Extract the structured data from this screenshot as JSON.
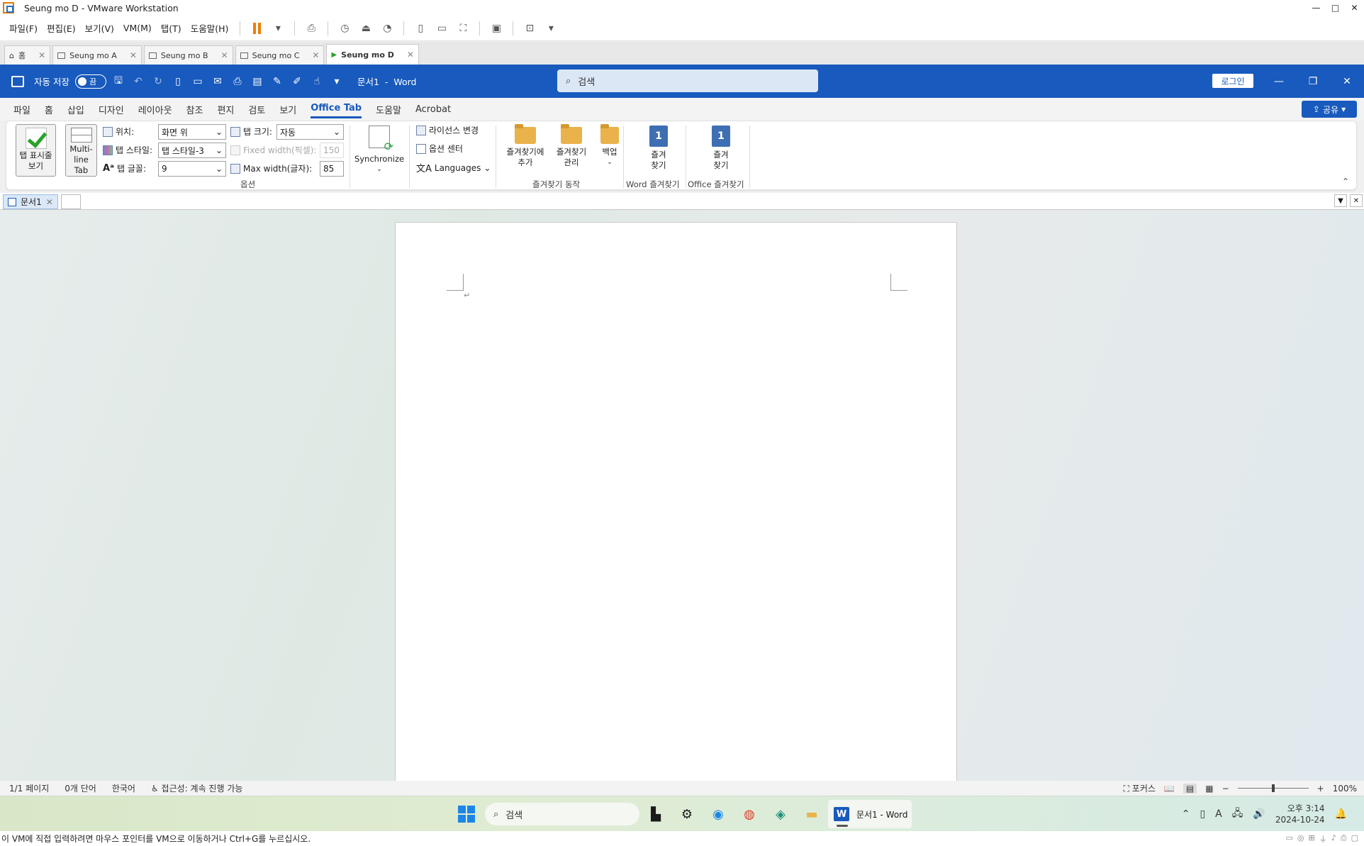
{
  "vmware": {
    "window_title": "Seung mo D - VMware Workstation",
    "menu": [
      "파일(F)",
      "편집(E)",
      "보기(V)",
      "VM(M)",
      "탭(T)",
      "도움말(H)"
    ],
    "tabs": [
      {
        "label": "홈"
      },
      {
        "label": "Seung mo A"
      },
      {
        "label": "Seung mo B"
      },
      {
        "label": "Seung mo C"
      },
      {
        "label": "Seung mo D"
      }
    ],
    "hint": "이 VM에 직접 입력하려면 마우스 포인터를 VM으로 이동하거나 Ctrl+G를 누르십시오."
  },
  "word": {
    "autosave_label": "자동 저장",
    "autosave_state": "끔",
    "doc_title": "문서1",
    "app_name": "Word",
    "separator": "-",
    "search_placeholder": "검색",
    "login_label": "로그인",
    "share_label": "공유",
    "ribbon_tabs": [
      "파일",
      "홈",
      "삽입",
      "디자인",
      "레이아웃",
      "참조",
      "편지",
      "검토",
      "보기",
      "Office Tab",
      "도움말",
      "Acrobat"
    ],
    "active_tab": "Office Tab"
  },
  "ribbon": {
    "show_tabs_label": "탭 표시줄\n보기",
    "multiline_label": "Multi-\nline Tab",
    "position_label": "위치:",
    "position_value": "화면 위",
    "style_label": "탭 스타일:",
    "style_value": "탭 스타일-3",
    "font_label": "탭 글꼴:",
    "font_value": "9",
    "size_label": "탭 크기:",
    "size_value": "자동",
    "fixed_width_label": "Fixed width(픽셀):",
    "fixed_width_value": "150",
    "max_width_label": "Max width(글자):",
    "max_width_value": "85",
    "options_group": "옵션",
    "synchronize_label": "Synchronize",
    "license_label": "라이선스 변경",
    "option_center_label": "옵션 센터",
    "languages_label": "Languages",
    "fav_add_label": "즐겨찾기에\n추가",
    "fav_manage_label": "즐겨찾기\n관리",
    "backup_label": "백업",
    "fav_actions_group": "즐겨찾기 동작",
    "word_fav_btn": "즐겨\n찾기",
    "word_fav_group": "Word 즐겨찾기",
    "office_fav_btn": "즐겨\n찾기",
    "office_fav_group": "Office 즐겨찾기",
    "book_number": "1"
  },
  "doc_tabs": [
    {
      "label": "문서1"
    }
  ],
  "document": {
    "para_mark": "↵"
  },
  "statusbar": {
    "page": "1/1 페이지",
    "words": "0개 단어",
    "language": "한국어",
    "accessibility": "접근성: 계속 진행 가능",
    "focus": "포커스",
    "zoom": "100%",
    "zoom_level": 0.5
  },
  "taskbar": {
    "search_placeholder": "검색",
    "word_window": "문서1 - Word",
    "word_letter": "W",
    "time": "오후 3:14",
    "date": "2024-10-24"
  },
  "icons": {
    "home": "home-icon",
    "pause": "pause-icon",
    "search": "search-icon",
    "save": "save-icon",
    "undo": "undo-icon",
    "redo": "redo-icon",
    "folder": "folder-icon",
    "book": "book-icon",
    "gear": "gear-icon",
    "edge": "edge-icon",
    "chrome": "chrome-icon",
    "files": "file-explorer-icon"
  },
  "colors": {
    "word_blue": "#185abd",
    "vm_orange": "#f07d00",
    "check_green": "#2aa22a"
  }
}
